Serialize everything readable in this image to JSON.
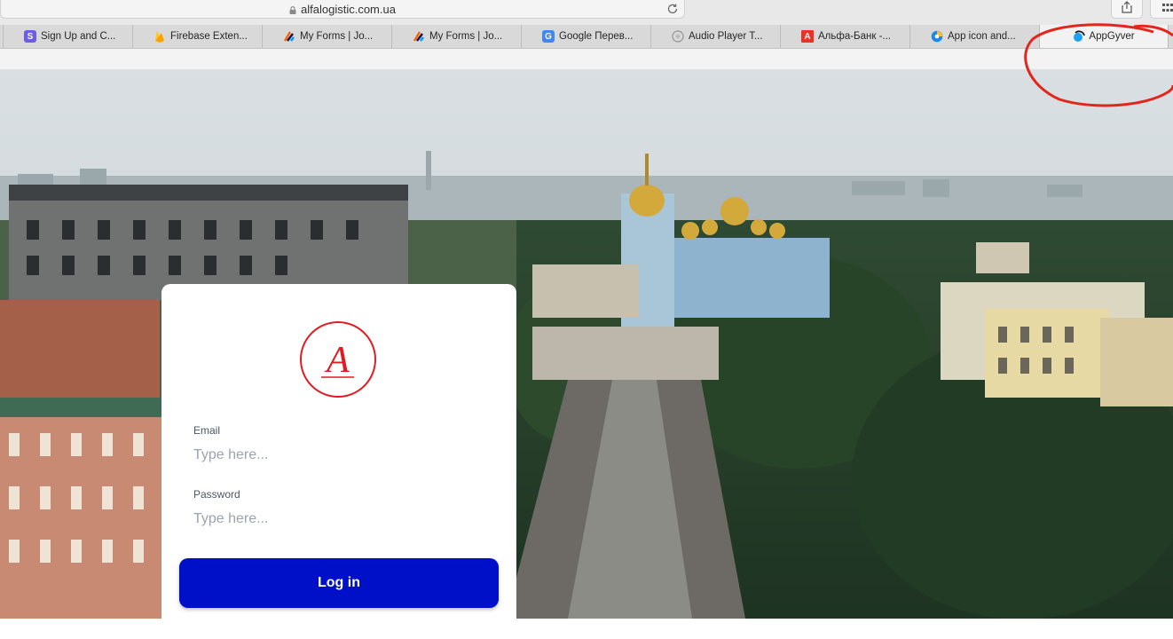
{
  "browser": {
    "url": "alfalogistic.com.ua",
    "tabs": [
      {
        "label": "Sign Up and C...",
        "icon": "s-logo-icon",
        "color": "#6c5ce7",
        "glyph": "S"
      },
      {
        "label": "Firebase Exten...",
        "icon": "firebase-icon",
        "color": "#ffca28",
        "glyph": ""
      },
      {
        "label": "My Forms | Jo...",
        "icon": "jotform-icon",
        "color": "#ff6100",
        "glyph": ""
      },
      {
        "label": "My Forms | Jo...",
        "icon": "jotform-icon",
        "color": "#ff6100",
        "glyph": ""
      },
      {
        "label": "Google Перев...",
        "icon": "google-translate-icon",
        "color": "#4285f4",
        "glyph": "G"
      },
      {
        "label": "Audio Player T...",
        "icon": "audio-player-icon",
        "color": "#9e9e9e",
        "glyph": ""
      },
      {
        "label": "Альфа-Банк -...",
        "icon": "alfa-bank-icon",
        "color": "#ef3124",
        "glyph": "A"
      },
      {
        "label": "App icon and...",
        "icon": "app-icon-icon",
        "color": "#1e88e5",
        "glyph": ""
      },
      {
        "label": "AppGyver",
        "icon": "appgyver-icon",
        "color": "#1da1f2",
        "glyph": ""
      }
    ],
    "active_tab_index": 8
  },
  "login": {
    "logo_letter": "A",
    "logo_color": "#e11b22",
    "email_label": "Email",
    "email_placeholder": "Type here...",
    "password_label": "Password",
    "password_placeholder": "Type here...",
    "button_label": "Log in",
    "button_color": "#0010c8"
  },
  "annotation": {
    "color": "#e3261c"
  }
}
